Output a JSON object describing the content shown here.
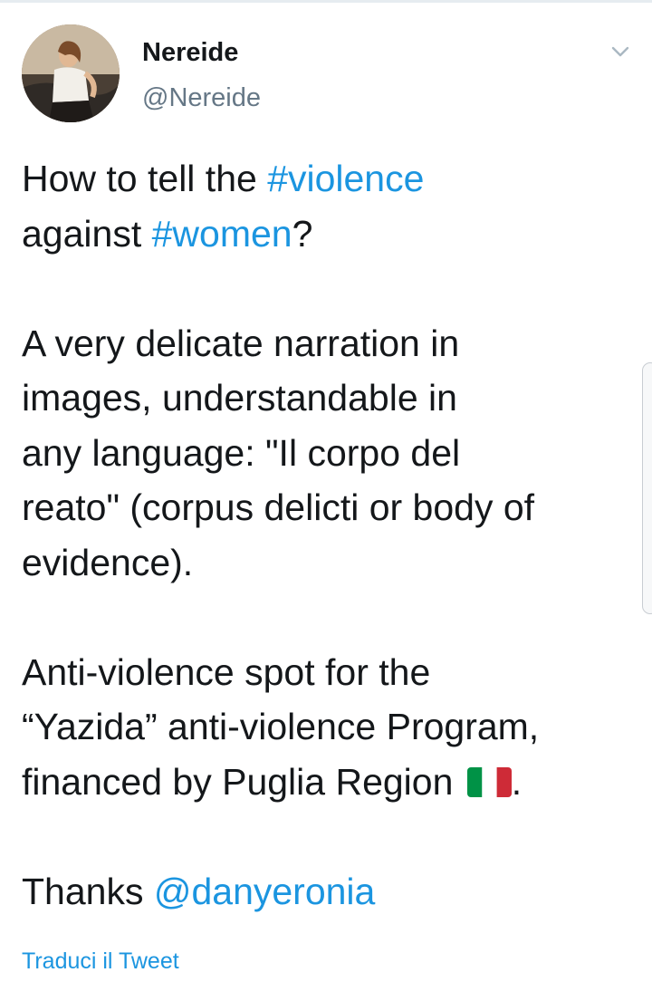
{
  "author": {
    "display_name": "Nereide",
    "handle": "@Nereide",
    "avatar_icon": "profile-photo"
  },
  "menu": {
    "icon": "chevron-down-icon"
  },
  "tweet": {
    "line1_prefix": "How to tell the ",
    "hashtag_violence": "#violence",
    "line2_prefix": "against ",
    "hashtag_women": "#women",
    "line2_suffix": "?",
    "paragraph2": "A very delicate narration in\nimages, understandable in\nany language: \"Il corpo del\nreato\" (corpus delicti or body of\nevidence).",
    "paragraph3_text": "Anti-violence spot for the\n“Yazida” anti-violence Program,\nfinanced by Puglia Region ",
    "flag_icon": "italian-flag-icon",
    "paragraph3_suffix": ".",
    "thanks_prefix": "Thanks ",
    "mention": "@danyeronia"
  },
  "translate_label": "Traduci il Tweet",
  "colors": {
    "link": "#1b95e0",
    "text": "#14171a",
    "secondary": "#657786",
    "flag_green": "#009246",
    "flag_white": "#ffffff",
    "flag_red": "#ce2b37"
  }
}
